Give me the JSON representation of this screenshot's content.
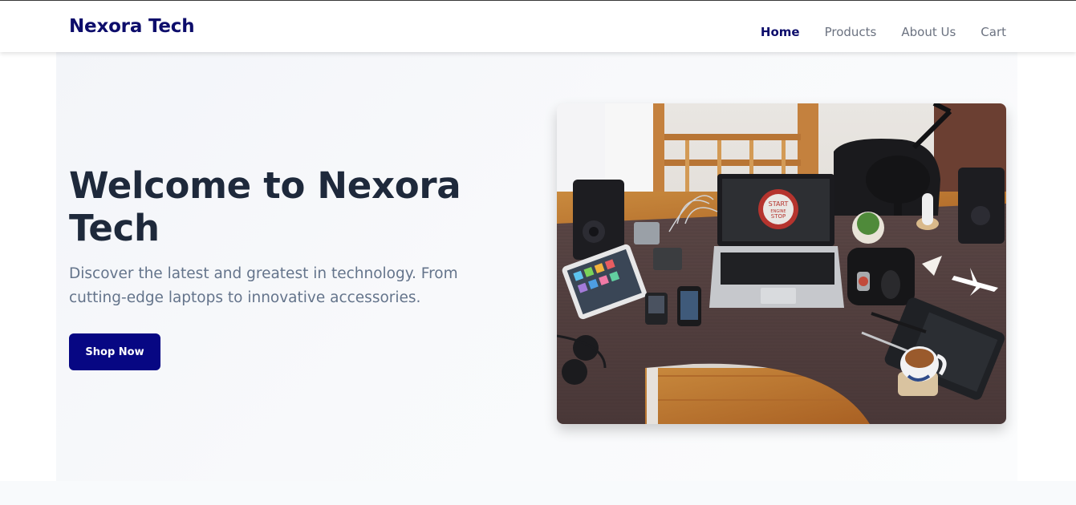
{
  "header": {
    "brand": "Nexora Tech",
    "nav": [
      {
        "label": "Home",
        "active": true
      },
      {
        "label": "Products",
        "active": false
      },
      {
        "label": "About Us",
        "active": false
      },
      {
        "label": "Cart",
        "active": false
      }
    ]
  },
  "hero": {
    "title": "Welcome to Nexora Tech",
    "description": "Discover the latest and greatest in technology. From cutting-edge laptops to innovative accessories.",
    "cta_label": "Shop Now",
    "image": {
      "icon": "desk-workspace-photo",
      "button_text": [
        "START",
        "ENGINE",
        "STOP"
      ]
    }
  },
  "colors": {
    "brand": "#0d0d6b",
    "button": "#070783",
    "heading": "#1e293b",
    "muted": "#64748b"
  }
}
